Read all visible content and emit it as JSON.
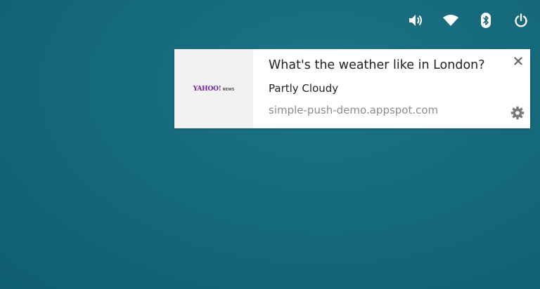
{
  "tray": {
    "icons": [
      "volume-icon",
      "wifi-icon",
      "bluetooth-icon",
      "power-icon"
    ]
  },
  "notification": {
    "image": {
      "brand_word": "YAHOO!",
      "brand_sub": "NEWS",
      "brand_color": "#6b1f9e"
    },
    "title": "What's the weather like in London?",
    "message": "Partly Cloudy",
    "source": "simple-push-demo.appspot.com",
    "close_icon": "close-icon",
    "settings_icon": "gear-icon"
  },
  "colors": {
    "desktop_background": "#156a7b",
    "notification_background": "#ffffff",
    "source_text": "#8c8c8c"
  }
}
